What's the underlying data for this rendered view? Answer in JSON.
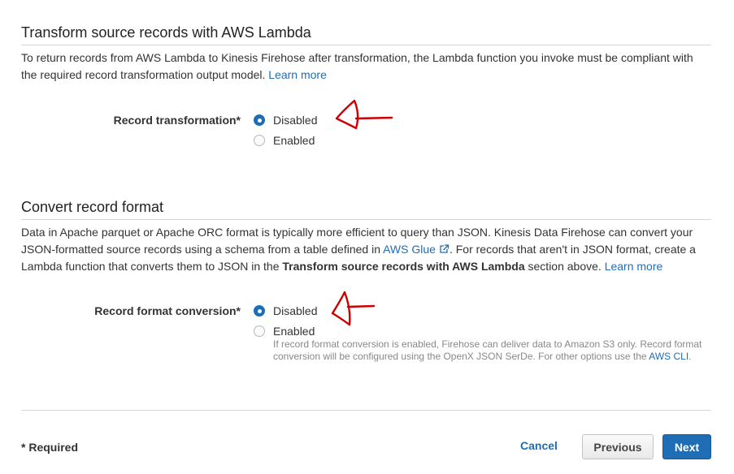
{
  "transform": {
    "title": "Transform source records with AWS Lambda",
    "description": "To return records from AWS Lambda to Kinesis Firehose after transformation, the Lambda function you invoke must be compliant with the required record transformation output model.",
    "learn_more": "Learn more",
    "field_label": "Record transformation*",
    "options": [
      {
        "label": "Disabled",
        "checked": true
      },
      {
        "label": "Enabled",
        "checked": false
      }
    ]
  },
  "convert": {
    "title": "Convert record format",
    "desc_part1": "Data in Apache parquet or Apache ORC format is typically more efficient to query than JSON. Kinesis Data Firehose can convert your JSON-formatted source records using a schema from a table defined in",
    "glue_link": "AWS Glue",
    "desc_part2": ". For records that aren't in JSON format, create a Lambda function that converts them to JSON in the",
    "desc_bold": "Transform source records with AWS Lambda",
    "desc_part3": "section above.",
    "learn_more": "Learn more",
    "field_label": "Record format conversion*",
    "options": [
      {
        "label": "Disabled",
        "checked": true
      },
      {
        "label": "Enabled",
        "checked": false
      }
    ],
    "help_text": "If record format conversion is enabled, Firehose can deliver data to Amazon S3 only. Record format conversion will be configured using the OpenX JSON SerDe. For other options use the",
    "help_link": "AWS CLI",
    "help_end": "."
  },
  "footer": {
    "required": "* Required",
    "cancel": "Cancel",
    "previous": "Previous",
    "next": "Next"
  },
  "colors": {
    "accent": "#1f6db4",
    "annotation": "#cc0000"
  }
}
